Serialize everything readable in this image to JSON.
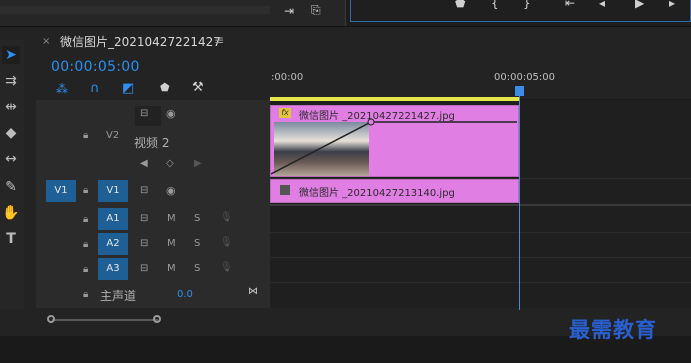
{
  "sequence_tab": {
    "title": "微信图片_20210427221427",
    "close_glyph": "×",
    "menu_glyph": "≡"
  },
  "timecode": "00:00:05:00",
  "ruler": {
    "start_label": ":00:00",
    "marker_label": "00:00:05:00"
  },
  "tracks": {
    "v2": {
      "source_label": "",
      "name": "V2",
      "label_name": "视频 2"
    },
    "v1": {
      "source_label": "V1",
      "name": "V1"
    },
    "a1": {
      "name": "A1",
      "m": "M",
      "s": "S"
    },
    "a2": {
      "name": "A2",
      "m": "M",
      "s": "S"
    },
    "a3": {
      "name": "A3",
      "m": "M",
      "s": "S"
    },
    "master": {
      "name": "主声道",
      "value": "0.0"
    }
  },
  "clips": {
    "v2_clip": {
      "fx": "fx",
      "label": "微信图片 _20210427221427.jpg"
    },
    "v1_clip": {
      "label": "微信图片 _20210427213140.jpg"
    }
  },
  "watermark": "最需教育",
  "colors": {
    "accent": "#2e8ff0",
    "clip": "#e17ee3",
    "track_blue": "#1e5f96"
  }
}
